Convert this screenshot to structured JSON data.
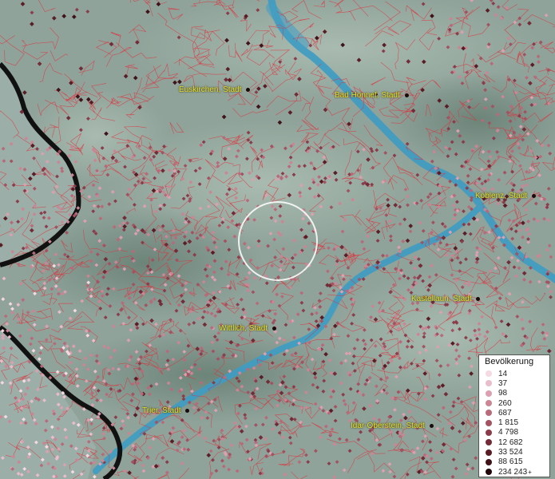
{
  "map": {
    "cities": [
      {
        "name": "Euskirchen, Stadt",
        "id": "euskirchen"
      },
      {
        "name": "Bad Honnef, Stadt",
        "id": "bad-honnef"
      },
      {
        "name": "Koblenz, Stadt",
        "id": "koblenz"
      },
      {
        "name": "Kastellaun, Stadt",
        "id": "kastellaun"
      },
      {
        "name": "Wittlich, Stadt",
        "id": "wittlich"
      },
      {
        "name": "Trier, Stadt",
        "id": "trier"
      },
      {
        "name": "Idar-Oberstein, Stadt",
        "id": "idar-oberstein"
      }
    ]
  },
  "legend": {
    "title": "Bevölkerung",
    "items": [
      {
        "label": "14",
        "color": "#f6d9e3"
      },
      {
        "label": "37",
        "color": "#ebbccb"
      },
      {
        "label": "98",
        "color": "#dca0b0"
      },
      {
        "label": "260",
        "color": "#cc8595"
      },
      {
        "label": "687",
        "color": "#b96a7a"
      },
      {
        "label": "1 815",
        "color": "#a25261"
      },
      {
        "label": "4 798",
        "color": "#8a3c4b"
      },
      {
        "label": "12 682",
        "color": "#722b37"
      },
      {
        "label": "33 524",
        "color": "#5a1d26"
      },
      {
        "label": "88 615",
        "color": "#401219"
      },
      {
        "label": "234 243",
        "color": "#22080c",
        "plus": "+"
      }
    ]
  },
  "colors": {
    "terrain": "#8fa39a",
    "water": "#3d9cc4",
    "boundary": "#e0303a",
    "border": "#111111",
    "label": "#e8e23a"
  }
}
